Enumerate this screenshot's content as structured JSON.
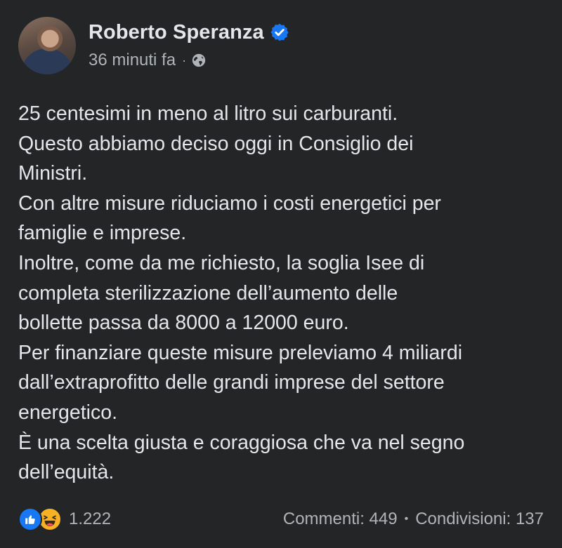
{
  "author": {
    "name": "Roberto Speranza",
    "time_ago": "36 minuti fa",
    "separator": "·"
  },
  "post": {
    "lines": [
      "25 centesimi in meno al litro sui carburanti.",
      "Questo abbiamo deciso oggi in Consiglio dei",
      "Ministri.",
      "Con altre misure riduciamo i costi energetici per",
      "famiglie e imprese.",
      "Inoltre, come da me richiesto, la soglia Isee di",
      "completa sterilizzazione dell’aumento delle",
      "bollette passa da 8000 a 12000 euro.",
      "Per finanziare queste misure preleviamo 4 miliardi",
      "dall’extraprofitto delle grandi imprese del settore",
      "energetico.",
      "È una scelta giusta e coraggiosa che va nel segno",
      "dell’equità."
    ]
  },
  "footer": {
    "reaction_count": "1.222",
    "comments": "Commenti: 449",
    "bullet": "•",
    "shares": "Condivisioni: 137"
  },
  "icons": {
    "verified": "verified-badge-icon",
    "privacy": "globe-icon",
    "reaction_1": "like-icon",
    "reaction_2": "haha-icon"
  },
  "colors": {
    "background": "#242526",
    "text_primary": "#e4e6eb",
    "text_secondary": "#b0b3b8",
    "accent_blue": "#1877f2",
    "haha_yellow": "#f7b125"
  }
}
